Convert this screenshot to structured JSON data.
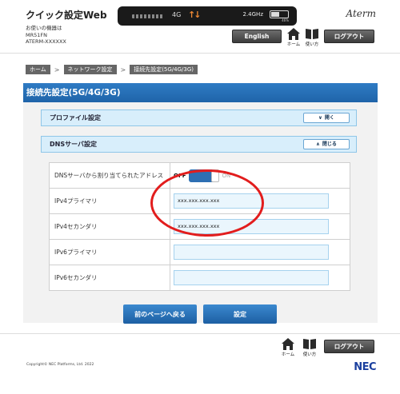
{
  "header": {
    "app_title": "クイック設定Web",
    "device_label": "お使いの機器は",
    "device_model": "MR51FN",
    "device_id": "ATERM-XXXXXX",
    "status": {
      "network": "4G",
      "battery_text": "2.4GHz",
      "battery_percent": "46%"
    },
    "brand": "Aterm",
    "english_button": "English",
    "home_label": "ホーム",
    "help_label": "使い方",
    "logout_button": "ログアウト"
  },
  "breadcrumb": [
    "ホーム",
    "ネットワーク設定",
    "接続先設定(5G/4G/3G)"
  ],
  "page_title": "接続先設定(5G/4G/3G)",
  "profile_section": {
    "title": "プロファイル設定",
    "button": "開く"
  },
  "dns_section": {
    "title": "DNSサーバ設定",
    "button": "閉じる"
  },
  "dns_table": {
    "auto_assign_label": "DNSサーバから割り当てられたアドレス",
    "toggle_off": "OFF",
    "toggle_on": "ON",
    "rows": [
      {
        "label": "IPv4プライマリ",
        "value": "xxx.xxx.xxx.xxx"
      },
      {
        "label": "IPv4セカンダリ",
        "value": "xxx.xxx.xxx.xxx"
      },
      {
        "label": "IPv6プライマリ",
        "value": ""
      },
      {
        "label": "IPv6セカンダリ",
        "value": ""
      }
    ]
  },
  "actions": {
    "back_button": "前のページへ戻る",
    "set_button": "設定"
  },
  "footer": {
    "home_label": "ホーム",
    "help_label": "使い方",
    "logout_button": "ログアウト",
    "copyright": "Copyright© NEC Platforms, Ltd. 2022",
    "logo": "NEC"
  },
  "colors": {
    "accent": "#1f64a9",
    "annotation": "#e21d1d",
    "section_bg": "#d8eefb"
  }
}
